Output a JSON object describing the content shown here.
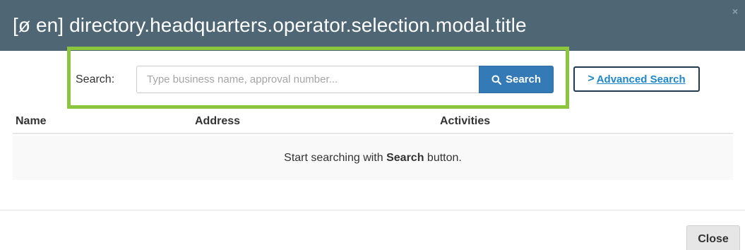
{
  "modal": {
    "title": "[ø en] directory.headquarters.operator.selection.modal.title",
    "close_glyph": "×"
  },
  "search": {
    "label": "Search:",
    "placeholder": "Type business name, approval number...",
    "value": "",
    "button_label": "Search",
    "highlight_color": "#8cc63f"
  },
  "advanced_search": {
    "chevron": ">",
    "label": "Advanced Search"
  },
  "results": {
    "columns": [
      "Name",
      "Address",
      "Activities"
    ],
    "empty_message_prefix": "Start searching with ",
    "empty_message_bold": "Search",
    "empty_message_suffix": " button."
  },
  "footer": {
    "close_label": "Close"
  },
  "colors": {
    "header_bg": "#4f6675",
    "primary_button": "#337ab7",
    "link": "#1f87c7"
  }
}
